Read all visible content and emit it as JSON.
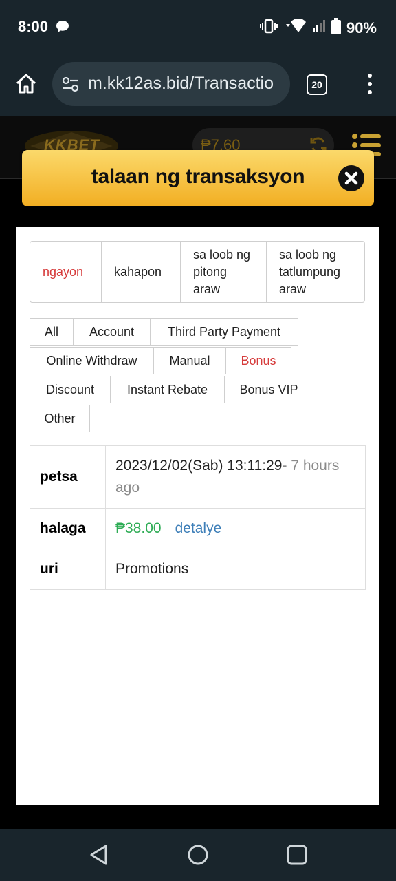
{
  "status_bar": {
    "time": "8:00",
    "battery": "90%"
  },
  "browser": {
    "url": "m.kk12as.bid/Transactio",
    "tab_count": "20"
  },
  "site": {
    "logo_text": "KKBET",
    "balance": "₱7.60"
  },
  "modal": {
    "title": "talaan ng transaksyon"
  },
  "date_tabs": [
    {
      "label": "ngayon"
    },
    {
      "label": "kahapon"
    },
    {
      "label": "sa loob ng pitong araw"
    },
    {
      "label": "sa loob ng tatlumpung araw"
    }
  ],
  "filters": [
    {
      "label": "All"
    },
    {
      "label": "Account"
    },
    {
      "label": "Third Party Payment"
    },
    {
      "label": "Online Withdraw"
    },
    {
      "label": "Manual"
    },
    {
      "label": "Bonus"
    },
    {
      "label": "Discount"
    },
    {
      "label": "Instant Rebate"
    },
    {
      "label": "Bonus VIP"
    },
    {
      "label": "Other"
    }
  ],
  "record": {
    "date_label": "petsa",
    "date_value": "2023/12/02(Sab) 13:11:29",
    "date_relative": "- 7 hours ago",
    "amount_label": "halaga",
    "amount_value": "₱38.00",
    "detail_link": "detalye",
    "type_label": "uri",
    "type_value": "Promotions"
  },
  "colors": {
    "accent_gold": "#f2ae22",
    "active_red": "#d63b3b",
    "amount_green": "#2eac55",
    "link_blue": "#3e7fb8"
  }
}
